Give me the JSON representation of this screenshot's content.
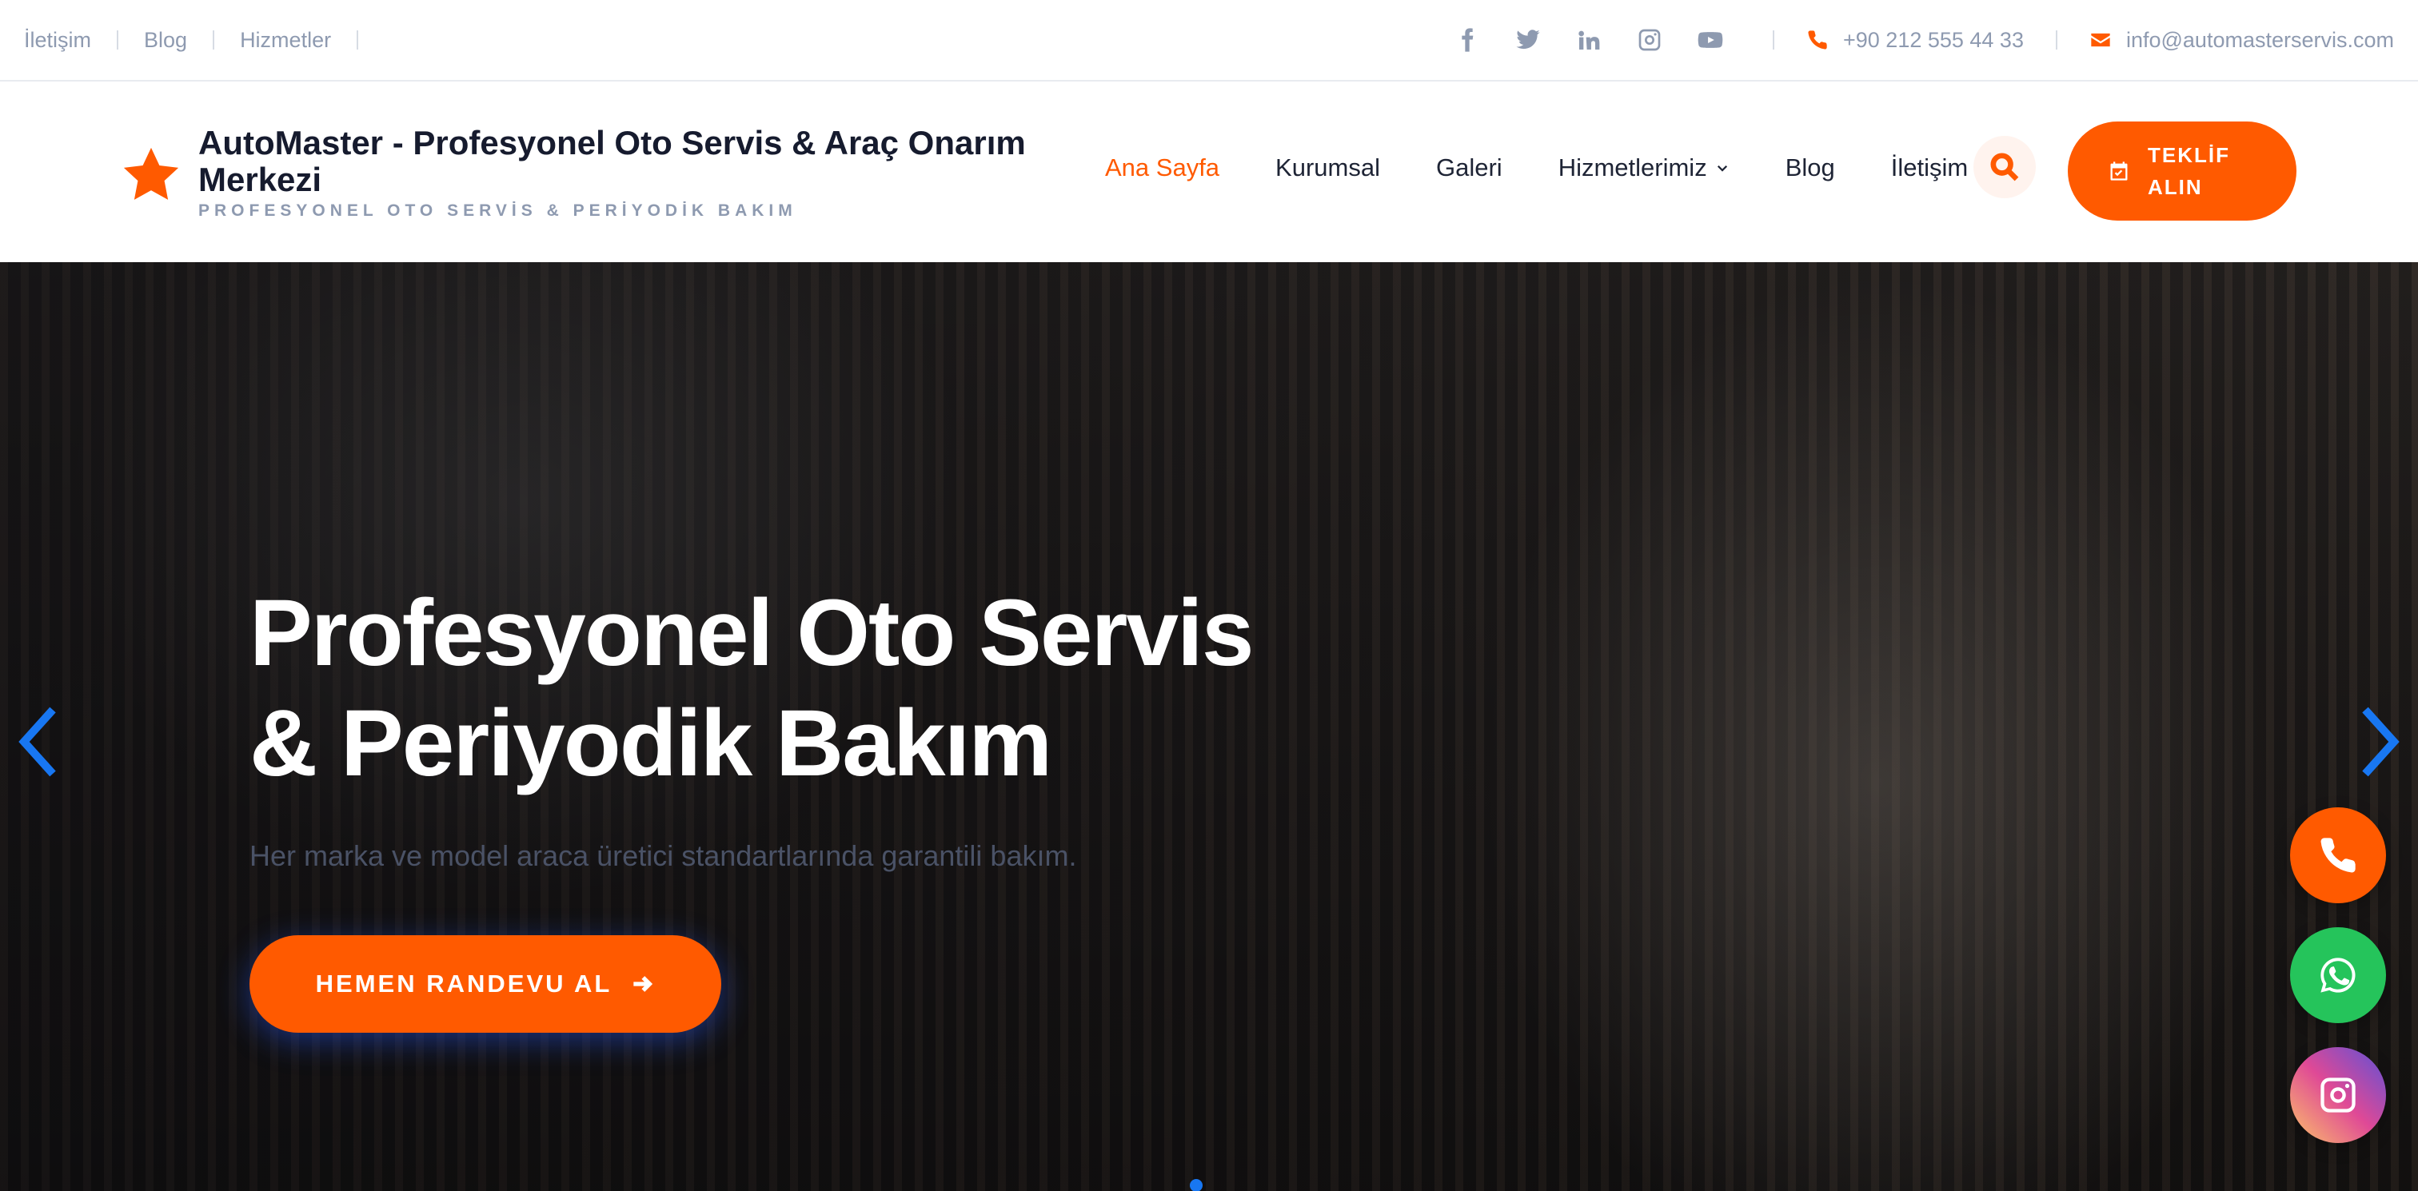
{
  "topbar": {
    "links": [
      "İletişim",
      "Blog",
      "Hizmetler"
    ],
    "social": [
      "facebook-icon",
      "twitter-icon",
      "linkedin-icon",
      "instagram-icon",
      "youtube-icon"
    ],
    "phone": "+90 212 555 44 33",
    "email": "info@automasterservis.com"
  },
  "brand": {
    "title": "AutoMaster - Profesyonel Oto Servis & Araç Onarım Merkezi",
    "subtitle": "PROFESYONEL OTO SERVİS & PERİYODİK BAKIM"
  },
  "nav": {
    "items": [
      "Ana Sayfa",
      "Kurumsal",
      "Galeri",
      "Hizmetlerimiz",
      "Blog",
      "İletişim"
    ],
    "active": "Ana Sayfa",
    "quote_label": "TEKLİF ALIN"
  },
  "hero": {
    "title_line1": "Profesyonel Oto Servis",
    "title_line2": "& Periyodik Bakım",
    "subtitle": "Her marka ve model araca üretici standartlarında garantili bakım.",
    "cta_label": "HEMEN RANDEVU AL"
  },
  "colors": {
    "accent": "#ff5a00",
    "slider_accent": "#1877f2",
    "whatsapp": "#25c45b"
  }
}
